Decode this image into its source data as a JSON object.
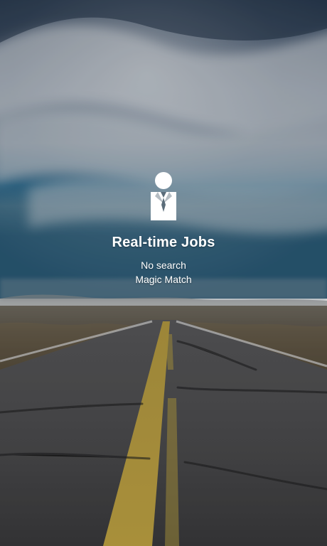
{
  "splash": {
    "title": "Real-time Jobs",
    "subtitle_line1": "No search",
    "subtitle_line2": "Magic Match",
    "icon": "business-person-icon"
  }
}
